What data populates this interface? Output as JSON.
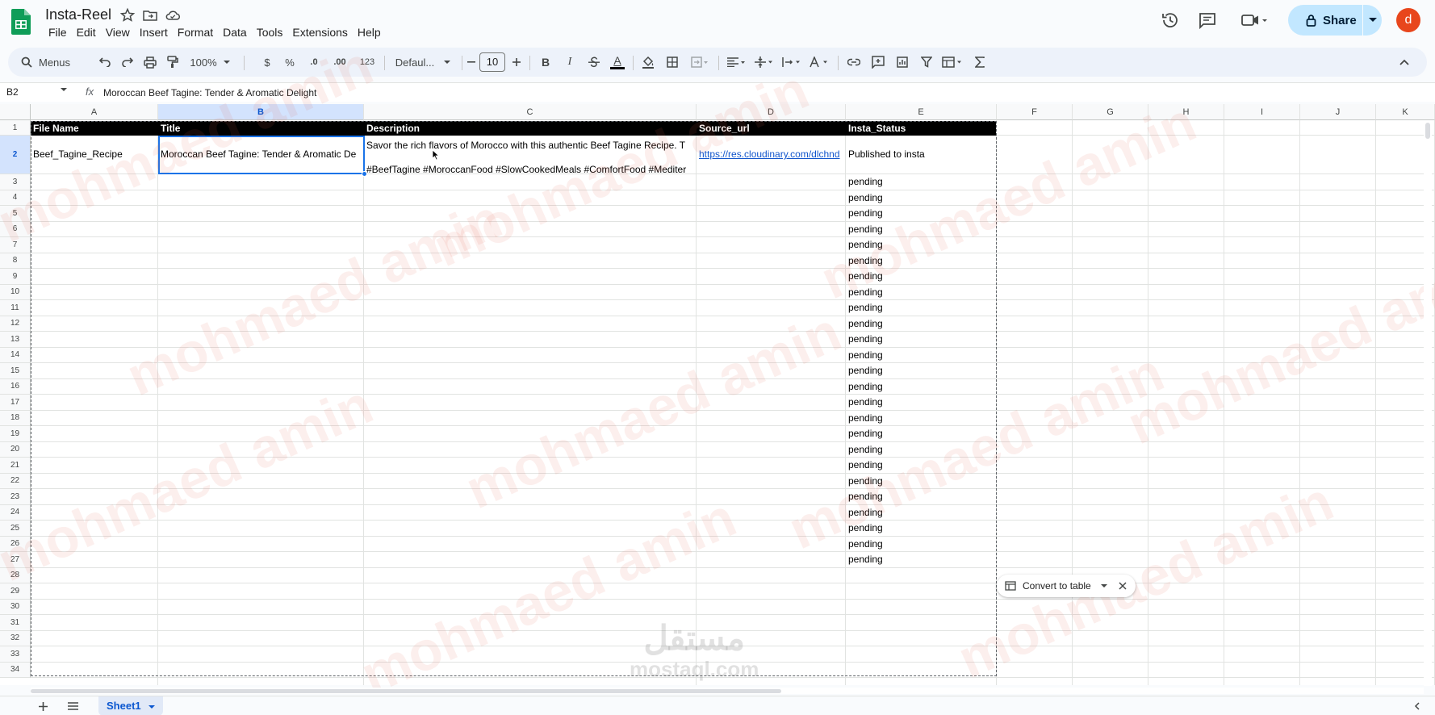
{
  "app": {
    "title": "Insta-Reel",
    "menu": [
      "File",
      "Edit",
      "View",
      "Insert",
      "Format",
      "Data",
      "Tools",
      "Extensions",
      "Help"
    ],
    "share_label": "Share",
    "avatar_letter": "d"
  },
  "toolbar": {
    "search_label": "Menus",
    "zoom": "100%",
    "currency": "$",
    "percent": "%",
    "decimal_less": ".0",
    "decimal_more": ".00",
    "number_format": "123",
    "font_name": "Defaul...",
    "font_size": "10",
    "bold": "B",
    "italic": "I",
    "text_color_letter": "A"
  },
  "formula_bar": {
    "cell_ref": "B2",
    "fx": "fx",
    "content": "Moroccan Beef Tagine: Tender & Aromatic Delight"
  },
  "columns": [
    "A",
    "B",
    "C",
    "D",
    "E",
    "F",
    "G",
    "H",
    "I",
    "J",
    "K"
  ],
  "rows": [
    "1",
    "2",
    "3",
    "4",
    "5",
    "6",
    "7",
    "8",
    "9",
    "10",
    "11",
    "12",
    "13",
    "14",
    "15",
    "16",
    "17",
    "18",
    "19",
    "20",
    "21",
    "22",
    "23",
    "24",
    "25",
    "26",
    "27",
    "28",
    "29",
    "30",
    "31",
    "32",
    "33",
    "34"
  ],
  "headers": {
    "file_name": "File Name",
    "title": "Title",
    "description": "Description",
    "source_url": "Source_url",
    "insta_status": "Insta_Status"
  },
  "row2": {
    "file_name": "Beef_Tagine_Recipe",
    "title": "Moroccan Beef Tagine: Tender & Aromatic De",
    "description_line1": "Savor the rich flavors of Morocco with this authentic Beef Tagine Recipe. T",
    "description_line2": "#BeefTagine #MoroccanFood #SlowCookedMeals #ComfortFood #Mediter",
    "source_url": "https://res.cloudinary.com/dlchnd",
    "status": "Published to insta"
  },
  "pending_label": "pending",
  "popup": {
    "label": "Convert to table"
  },
  "sheet_tab": "Sheet1",
  "watermark": {
    "text": "mohmaed amin",
    "logo_arabic": "مستقل",
    "logo_latin": "mostaql.com"
  },
  "colors": {
    "accent": "#1a73e8",
    "share_bg": "#c2e7ff",
    "header_row_bg": "#000000",
    "avatar": "#e8461c",
    "logo_green": "#0f9d58"
  }
}
